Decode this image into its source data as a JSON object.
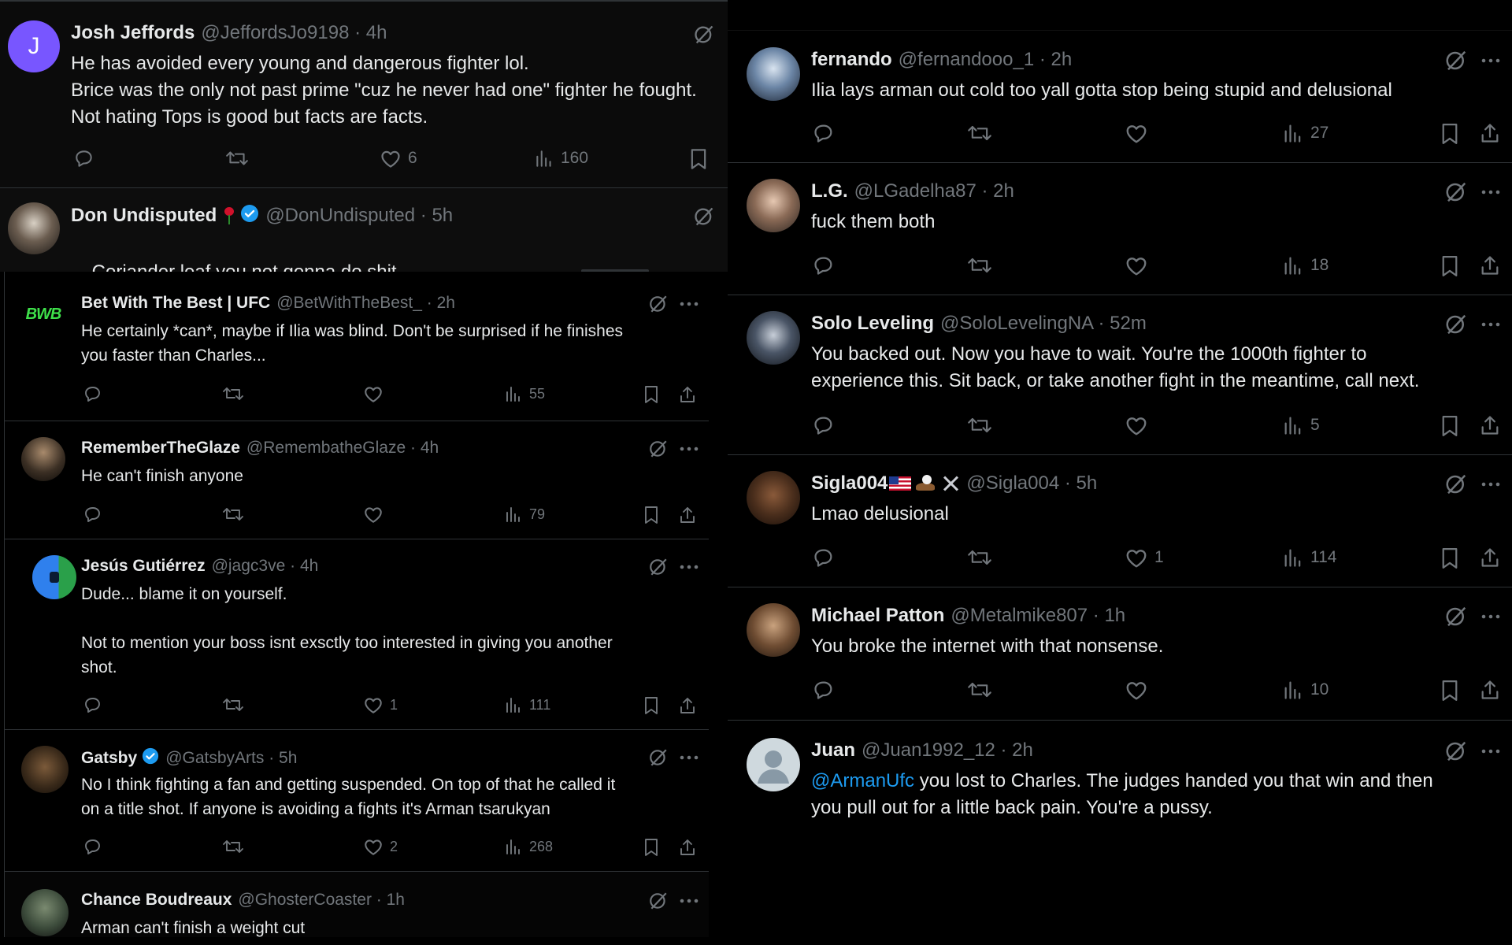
{
  "colors": {
    "background": "#000000",
    "text": "#e7e9ea",
    "secondary": "#71767b",
    "divider": "#2f3336",
    "link": "#1d9bf0",
    "verified": "#1d9bf0"
  },
  "icons": {
    "reply": "reply-icon",
    "repost": "repost-icon",
    "like": "like-icon",
    "views": "views-icon",
    "bookmark": "bookmark-icon",
    "share": "share-icon",
    "grok": "grok-icon",
    "more": "more-icon",
    "verified": "verified-badge-icon"
  },
  "top_left": {
    "p1": {
      "name": "Josh Jeffords",
      "handle": "@JeffordsJo9198 · 4h",
      "avatar_letter": "J",
      "text": "He has avoided every young and dangerous fighter lol.\nBrice was the only not past prime \"cuz he never had one\" fighter he fought.\nNot hating Tops is good but facts are facts.",
      "likes": "6",
      "views": "160"
    },
    "p2": {
      "name": "Don Undisputed",
      "handle": "@DonUndisputed · 5h",
      "text": "Coriander leaf you not gonna do shit"
    }
  },
  "left_thread": [
    {
      "name": "Bet With The Best | UFC",
      "handle": "@BetWithTheBest_ · 2h",
      "avatar_text": "BWB",
      "text": "He certainly *can*, maybe if Ilia was blind. Don't be surprised if he finishes\nyou faster than Charles...",
      "likes": "",
      "views": "55"
    },
    {
      "name": "RememberTheGlaze",
      "handle": "@RemembatheGlaze · 4h",
      "text": "He can't finish anyone",
      "likes": "",
      "views": "79"
    },
    {
      "name": "Jesús Gutiérrez",
      "handle": "@jagc3ve · 4h",
      "text": "Dude... blame it on yourself.\n\nNot to mention your boss isnt exsctly too interested in giving you another\nshot.",
      "likes": "1",
      "views": "111"
    },
    {
      "name": "Gatsby",
      "handle": "@GatsbyArts · 5h",
      "text": "No I think fighting a fan and getting suspended. On top of that he called it\non a title shot. If anyone is avoiding a fights it's Arman tsarukyan",
      "likes": "2",
      "views": "268"
    },
    {
      "name": "Chance Boudreaux",
      "handle": "@GhosterCoaster · 1h",
      "text": "Arman can't finish a weight cut"
    }
  ],
  "right_thread": [
    {
      "name": "fernando",
      "handle": "@fernandooo_1 · 2h",
      "text": "Ilia lays arman out cold too yall gotta stop being stupid and delusional",
      "likes": "",
      "views": "27"
    },
    {
      "name": "L.G.",
      "handle": "@LGadelha87 · 2h",
      "text": "fuck them both",
      "likes": "",
      "views": "18"
    },
    {
      "name": "Solo Leveling",
      "handle": "@SoloLevelingNA · 52m",
      "text": "You backed out. Now you have to wait. You're the 1000th fighter to\nexperience this. Sit back, or take another fight in the meantime, call next.",
      "likes": "",
      "views": "5"
    },
    {
      "name": "Sigla004",
      "handle": "@Sigla004 · 5h",
      "text": "Lmao delusional",
      "likes": "1",
      "views": "114"
    },
    {
      "name": "Michael Patton",
      "handle": "@Metalmike807 · 1h",
      "text": "You broke the internet with that nonsense.",
      "likes": "",
      "views": "10"
    },
    {
      "name": "Juan",
      "handle": "@Juan1992_12 · 2h",
      "mention": "@ArmanUfc",
      "text": " you lost to Charles. The judges handed you that win and then\nyou pull out for a little back pain. You're a pussy."
    }
  ]
}
